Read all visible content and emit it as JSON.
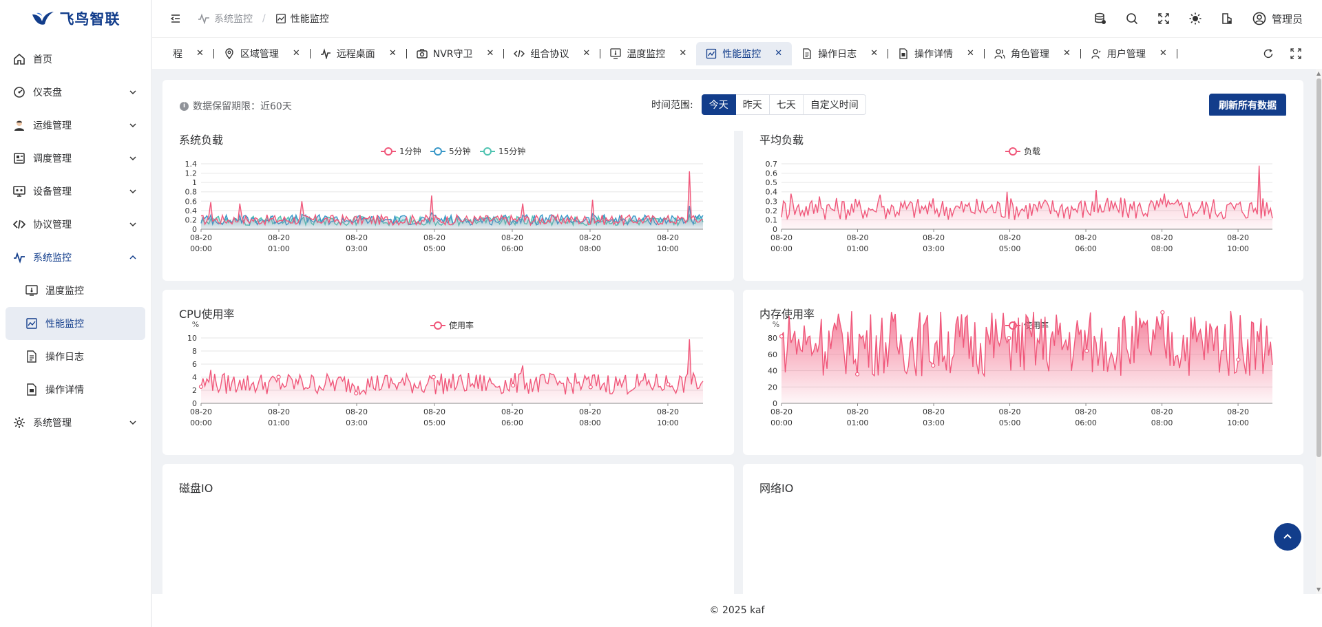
{
  "app": {
    "logo_text": "飞鸟智联"
  },
  "sidebar": {
    "items": [
      {
        "label": "首页",
        "icon": "home-icon",
        "has_children": false
      },
      {
        "label": "仪表盘",
        "icon": "dashboard-icon",
        "has_children": true
      },
      {
        "label": "运维管理",
        "icon": "operator-icon",
        "has_children": true
      },
      {
        "label": "调度管理",
        "icon": "schedule-icon",
        "has_children": true
      },
      {
        "label": "设备管理",
        "icon": "device-icon",
        "has_children": true
      },
      {
        "label": "协议管理",
        "icon": "code-icon",
        "has_children": true
      },
      {
        "label": "系统监控",
        "icon": "pulse-icon",
        "has_children": true,
        "open": true
      },
      {
        "label": "系统管理",
        "icon": "gear-icon",
        "has_children": true
      }
    ],
    "monitor_children": [
      {
        "label": "温度监控",
        "icon": "thermometer-icon"
      },
      {
        "label": "性能监控",
        "icon": "chart-icon",
        "active": true
      },
      {
        "label": "操作日志",
        "icon": "document-icon"
      },
      {
        "label": "操作详情",
        "icon": "document-detail-icon"
      }
    ]
  },
  "header": {
    "breadcrumb_parent": "系统监控",
    "breadcrumb_current": "性能监控",
    "breadcrumb_sep": "/",
    "user_name": "管理员"
  },
  "tabs": [
    {
      "label": "程",
      "icon": ""
    },
    {
      "label": "区域管理",
      "icon": "location-icon"
    },
    {
      "label": "远程桌面",
      "icon": "pulse-icon"
    },
    {
      "label": "NVR守卫",
      "icon": "camera-icon"
    },
    {
      "label": "组合协议",
      "icon": "code-icon"
    },
    {
      "label": "温度监控",
      "icon": "thermometer-icon"
    },
    {
      "label": "性能监控",
      "icon": "chart-icon",
      "active": true
    },
    {
      "label": "操作日志",
      "icon": "document-icon"
    },
    {
      "label": "操作详情",
      "icon": "document-detail-icon"
    },
    {
      "label": "角色管理",
      "icon": "users-icon"
    },
    {
      "label": "用户管理",
      "icon": "user-icon"
    }
  ],
  "toolbar": {
    "retention_text": "数据保留期限：近60天",
    "range_label": "时间范围:",
    "range_options": [
      "今天",
      "昨天",
      "七天",
      "自定义时间"
    ],
    "range_selected": "今天",
    "refresh_label": "刷新所有数据"
  },
  "cards": {
    "load_title": "系统负载",
    "avg_title": "平均负载",
    "cpu_title": "CPU使用率",
    "mem_title": "内存使用率",
    "disk_title": "磁盘IO",
    "net_title": "网络IO"
  },
  "footer": {
    "copyright": "© 2025 kaf"
  },
  "colors": {
    "brand": "#123d8b",
    "series_pink": "#f0577a",
    "series_blue": "#3a98c8",
    "series_teal": "#4fc3b1"
  },
  "chart_data": [
    {
      "type": "area",
      "title": "系统负载",
      "x_ticks": [
        [
          "08-20",
          "00:00"
        ],
        [
          "08-20",
          "01:00"
        ],
        [
          "08-20",
          "03:00"
        ],
        [
          "08-20",
          "05:00"
        ],
        [
          "08-20",
          "06:00"
        ],
        [
          "08-20",
          "08:00"
        ],
        [
          "08-20",
          "10:00"
        ]
      ],
      "ylim": [
        0,
        1.4
      ],
      "y_ticks": [
        0,
        0.2,
        0.4,
        0.6,
        0.8,
        1,
        1.2,
        1.4
      ],
      "series": [
        {
          "name": "1分钟",
          "color": "#f0577a",
          "baseline": 0.2,
          "spikes": [
            0.58,
            0.55,
            0.6,
            0.72,
            0.55,
            0.63,
            1.24
          ]
        },
        {
          "name": "5分钟",
          "color": "#3a98c8",
          "baseline": 0.2,
          "spikes": [
            0.3,
            0.3,
            0.32,
            0.35,
            0.3,
            0.33,
            0.5
          ]
        },
        {
          "name": "15分钟",
          "color": "#4fc3b1",
          "baseline": 0.18,
          "spikes": [
            0.22,
            0.22,
            0.22,
            0.24,
            0.22,
            0.23,
            0.3
          ]
        }
      ]
    },
    {
      "type": "area",
      "title": "平均负载",
      "x_ticks": [
        [
          "08-20",
          "00:00"
        ],
        [
          "08-20",
          "01:00"
        ],
        [
          "08-20",
          "03:00"
        ],
        [
          "08-20",
          "05:00"
        ],
        [
          "08-20",
          "06:00"
        ],
        [
          "08-20",
          "08:00"
        ],
        [
          "08-20",
          "10:00"
        ]
      ],
      "ylim": [
        0,
        0.7
      ],
      "y_ticks": [
        0,
        0.1,
        0.2,
        0.3,
        0.4,
        0.5,
        0.6,
        0.7
      ],
      "series": [
        {
          "name": "负载",
          "color": "#f0577a",
          "baseline": 0.22,
          "spikes": [
            0.38,
            0.35,
            0.37,
            0.4,
            0.42,
            0.38,
            0.68
          ]
        }
      ]
    },
    {
      "type": "area",
      "title": "CPU使用率",
      "unit": "%",
      "x_ticks": [
        [
          "08-20",
          "00:00"
        ],
        [
          "08-20",
          "01:00"
        ],
        [
          "08-20",
          "03:00"
        ],
        [
          "08-20",
          "05:00"
        ],
        [
          "08-20",
          "06:00"
        ],
        [
          "08-20",
          "08:00"
        ],
        [
          "08-20",
          "10:00"
        ]
      ],
      "ylim": [
        0,
        10
      ],
      "y_ticks": [
        0,
        2,
        4,
        6,
        8,
        10
      ],
      "series": [
        {
          "name": "使用率",
          "color": "#f0577a",
          "baseline": 3,
          "spikes": [
            5.1,
            3.6,
            3.5,
            3.8,
            5.8,
            4.3,
            9.8
          ]
        }
      ]
    },
    {
      "type": "area",
      "title": "内存使用率",
      "unit": "%",
      "x_ticks": [
        [
          "08-20",
          "00:00"
        ],
        [
          "08-20",
          "01:00"
        ],
        [
          "08-20",
          "03:00"
        ],
        [
          "08-20",
          "05:00"
        ],
        [
          "08-20",
          "06:00"
        ],
        [
          "08-20",
          "08:00"
        ],
        [
          "08-20",
          "10:00"
        ]
      ],
      "ylim": [
        0,
        80
      ],
      "y_ticks": [
        0,
        20,
        40,
        60,
        80
      ],
      "series": [
        {
          "name": "使用率",
          "color": "#f0577a",
          "baseline": 74,
          "spikes": [
            74,
            74,
            74,
            74,
            74,
            74,
            75
          ]
        }
      ]
    }
  ]
}
